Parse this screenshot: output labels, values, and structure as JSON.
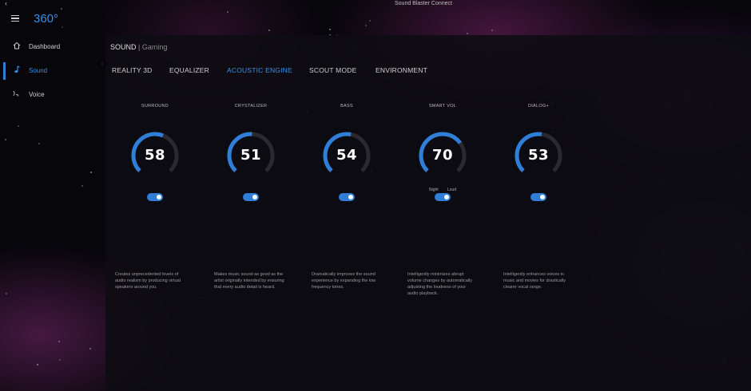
{
  "window": {
    "title": "Sound Blaster Connect",
    "back_glyph": "‹"
  },
  "app": {
    "brand": "360°"
  },
  "sidebar": {
    "items": [
      {
        "label": "Dashboard",
        "icon": "home-icon",
        "active": false
      },
      {
        "label": "Sound",
        "icon": "music-note-icon",
        "active": true
      },
      {
        "label": "Voice",
        "icon": "voice-icon",
        "active": false
      }
    ]
  },
  "main": {
    "breadcrumb": {
      "section": "SOUND",
      "separator": " | ",
      "profile": "Gaming"
    },
    "tabs": [
      {
        "label": "REALITY 3D",
        "active": false
      },
      {
        "label": "EQUALIZER",
        "active": false
      },
      {
        "label": "ACOUSTIC ENGINE",
        "active": true
      },
      {
        "label": "SCOUT MODE",
        "active": false
      },
      {
        "label": "ENVIRONMENT",
        "active": false
      }
    ],
    "features": [
      {
        "label": "SURROUND",
        "value": 58,
        "display": "58",
        "enabled": true,
        "description": "Creates unprecedented levels of audio realism by producing virtual speakers around you."
      },
      {
        "label": "CRYSTALIZER",
        "value": 51,
        "display": "51",
        "enabled": true,
        "description": "Makes music sound as good as the artist originally intended by ensuring that every audio detail is heard."
      },
      {
        "label": "BASS",
        "value": 54,
        "display": "54",
        "enabled": true,
        "description": "Dramatically improves the sound experience by expanding the low frequency tones."
      },
      {
        "label": "SMART VOL",
        "value": 70,
        "display": "70",
        "enabled": true,
        "night_label": "Night",
        "loud_label": "Loud",
        "description": "Intelligently minimizes abrupt volume changes by automatically adjusting the loudness of your audio playback."
      },
      {
        "label": "DIALOG+",
        "value": 53,
        "display": "53",
        "enabled": true,
        "description": "Intelligently enhances voices in music and movies for drastically clearer vocal range."
      }
    ]
  },
  "colors": {
    "accent": "#2f7fd8",
    "track": "#2a2a2e",
    "panel": "#0e0d12"
  }
}
